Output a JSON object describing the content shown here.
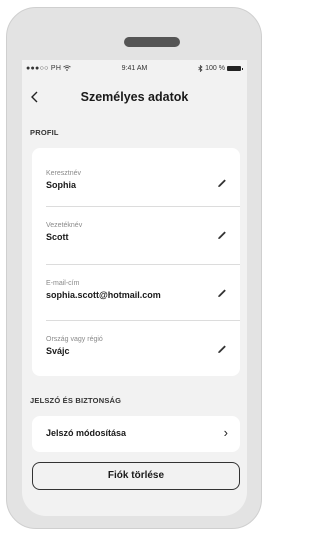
{
  "status_bar": {
    "carrier": "●●●○○ PH",
    "wifi": "wifi-icon",
    "time": "9:41 AM",
    "bluetooth": "bluetooth-icon",
    "battery": "100 %"
  },
  "header": {
    "back_icon": "chevron-left-icon",
    "title": "Személyes adatok"
  },
  "profile": {
    "section_title": "PROFIL",
    "fields": [
      {
        "label": "Keresztnév",
        "value": "Sophia"
      },
      {
        "label": "Vezetéknév",
        "value": "Scott"
      },
      {
        "label": "E-mail-cím",
        "value": "sophia.scott@hotmail.com"
      },
      {
        "label": "Ország vagy régió",
        "value": "Svájc"
      }
    ],
    "edit_icon": "pencil-icon"
  },
  "security": {
    "section_title": "JELSZÓ ÉS BIZTONSÁG",
    "change_password_label": "Jelszó módosítása",
    "chevron": "›"
  },
  "actions": {
    "delete_account_label": "Fiók törlése"
  }
}
